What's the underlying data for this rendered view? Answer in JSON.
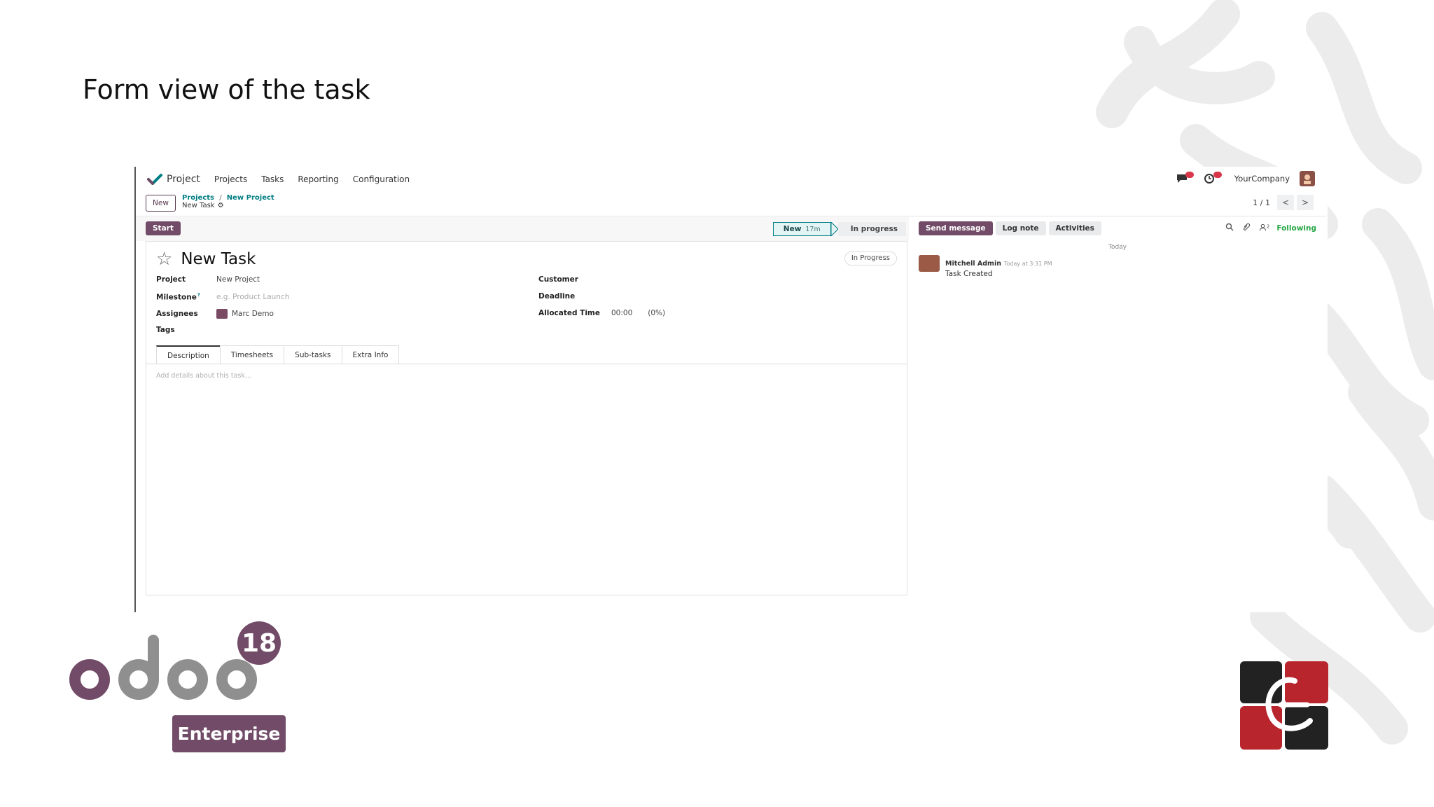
{
  "slide": {
    "title": "Form view of the task",
    "logo_version": "18",
    "logo_edition": "Enterprise",
    "logo_wordmark": "odoo"
  },
  "colors": {
    "brand_purple": "#714b67",
    "teal": "#017e84",
    "following_green": "#28a745",
    "badge_red": "#d9364a"
  },
  "navbar": {
    "app_name": "Project",
    "menu": [
      "Projects",
      "Tasks",
      "Reporting",
      "Configuration"
    ],
    "company": "YourCompany",
    "icons": [
      "chat-icon",
      "activity-clock-icon"
    ]
  },
  "control_panel": {
    "new_button": "New",
    "breadcrumb": {
      "root": "Projects",
      "separator": "/",
      "parent": "New Project",
      "current": "New Task"
    },
    "pager": {
      "value": "1 / 1",
      "prev": "<",
      "next": ">"
    }
  },
  "statusbar": {
    "start_button": "Start",
    "stages": [
      {
        "label": "New",
        "duration": "17m",
        "active": true
      },
      {
        "label": "In progress",
        "active": false
      }
    ]
  },
  "form": {
    "title": "New Task",
    "state": "In Progress",
    "left_fields": [
      {
        "label": "Project",
        "value": "New Project",
        "placeholder": ""
      },
      {
        "label": "Milestone",
        "value": "",
        "placeholder": "e.g. Product Launch"
      },
      {
        "label": "Assignees",
        "value": "Marc Demo",
        "placeholder": ""
      },
      {
        "label": "Tags",
        "value": "",
        "placeholder": ""
      }
    ],
    "right_fields": [
      {
        "label": "Customer",
        "value": ""
      },
      {
        "label": "Deadline",
        "value": ""
      },
      {
        "label": "Allocated Time",
        "value": "00:00",
        "extra": "(0%)"
      }
    ],
    "milestone_help": "?",
    "tabs": [
      "Description",
      "Timesheets",
      "Sub-tasks",
      "Extra Info"
    ],
    "active_tab": "Description",
    "description_placeholder": "Add details about this task..."
  },
  "chatter": {
    "send_message": "Send message",
    "log_note": "Log note",
    "activities": "Activities",
    "follower_count": "2",
    "following": "Following",
    "date_separator": "Today",
    "messages": [
      {
        "author": "Mitchell Admin",
        "time": "Today at 3:31 PM",
        "body": "Task Created"
      }
    ]
  }
}
